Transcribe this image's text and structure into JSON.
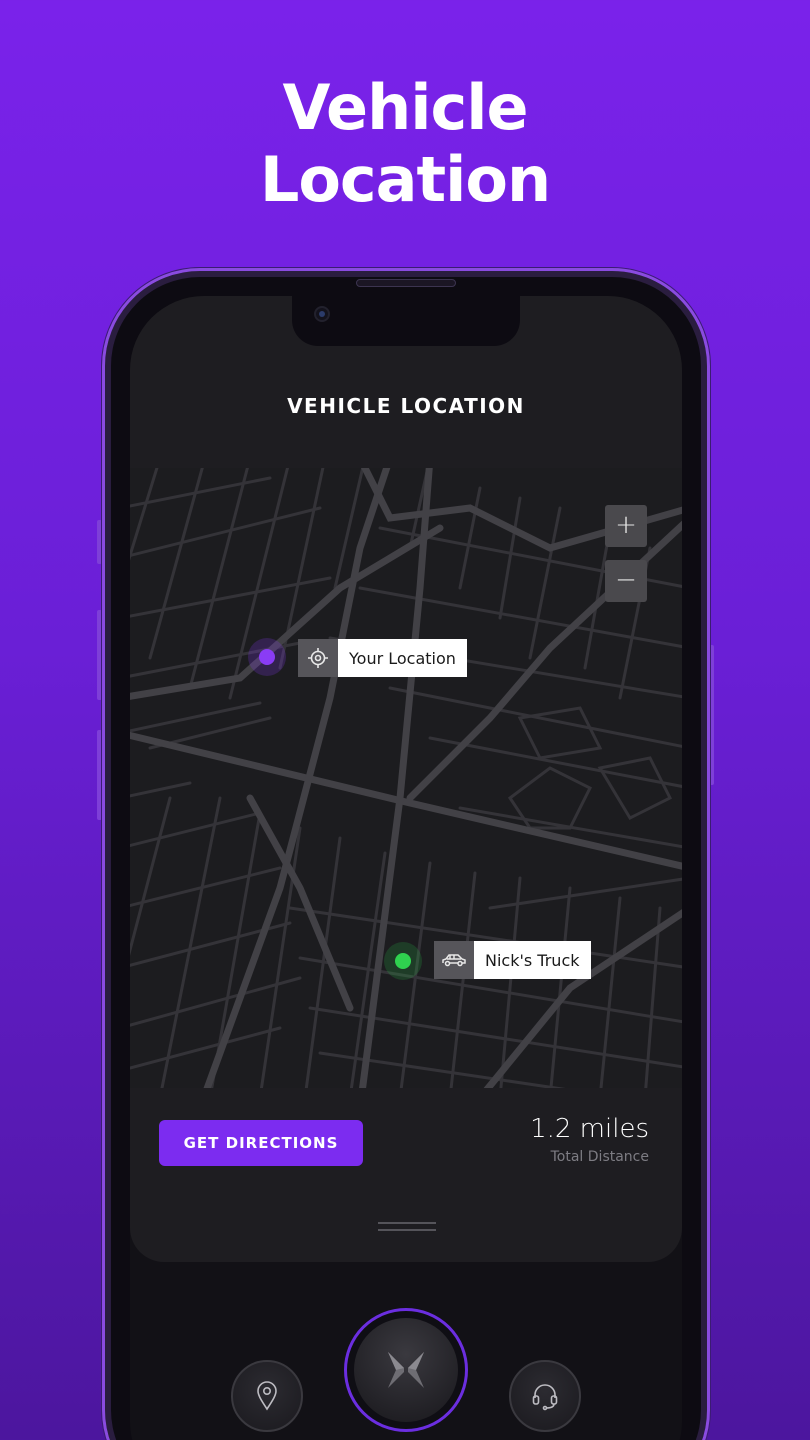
{
  "hero": {
    "title_line1": "Vehicle",
    "title_line2": "Location"
  },
  "screen": {
    "title": "VEHICLE LOCATION"
  },
  "map": {
    "zoom_in_label": "+",
    "zoom_out_label": "−",
    "user_marker": {
      "label": "Your Location",
      "icon": "crosshair-icon",
      "color": "#8a3cf5"
    },
    "vehicle_marker": {
      "label": "Nick's Truck",
      "icon": "car-icon",
      "color": "#2fd24f"
    }
  },
  "actions": {
    "directions_label": "GET DIRECTIONS"
  },
  "distance": {
    "value": "1.2 miles",
    "label": "Total Distance"
  },
  "dock": {
    "left_icon": "location-pin-icon",
    "center_icon": "brand-logo-icon",
    "right_icon": "headset-icon"
  },
  "colors": {
    "background_top": "#7a22ea",
    "accent": "#7c2cf0",
    "card": "#1e1d21",
    "map_road": "#3a393e"
  }
}
